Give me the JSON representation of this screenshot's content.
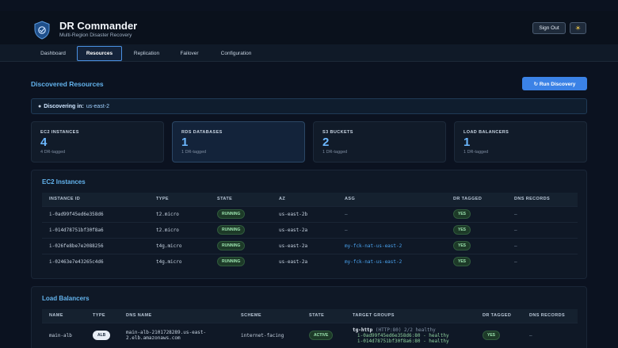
{
  "header": {
    "title": "DR Commander",
    "subtitle": "Multi-Region Disaster Recovery",
    "sign_out_label": "Sign Out",
    "theme_icon": "☀"
  },
  "nav": {
    "tabs": [
      {
        "label": "Dashboard"
      },
      {
        "label": "Resources"
      },
      {
        "label": "Replication"
      },
      {
        "label": "Failover"
      },
      {
        "label": "Configuration"
      }
    ],
    "active_tab": "Resources"
  },
  "main": {
    "title": "Discovered Resources",
    "run_button_label": "↻ Run Discovery",
    "discovering_label": "Discovering in:",
    "discovering_region": "us-east-2",
    "stats": [
      {
        "label": "EC2 INSTANCES",
        "value": "4",
        "sub": "4 DR-tagged"
      },
      {
        "label": "RDS DATABASES",
        "value": "1",
        "sub": "1 DR-tagged"
      },
      {
        "label": "S3 BUCKETS",
        "value": "2",
        "sub": "1 DR-tagged"
      },
      {
        "label": "LOAD BALANCERS",
        "value": "1",
        "sub": "1 DR-tagged"
      }
    ]
  },
  "ec2": {
    "title": "EC2 Instances",
    "columns": [
      "INSTANCE ID",
      "TYPE",
      "STATE",
      "AZ",
      "ASG",
      "DR TAGGED",
      "DNS RECORDS"
    ],
    "rows": [
      {
        "id": "i-0ad99f45ed6e358d6",
        "type": "t2.micro",
        "state": "RUNNING",
        "az": "us-east-2b",
        "asg": "—",
        "dr": "YES",
        "dns": "—"
      },
      {
        "id": "i-014d78751bf30f8a6",
        "type": "t2.micro",
        "state": "RUNNING",
        "az": "us-east-2a",
        "asg": "—",
        "dr": "YES",
        "dns": "—"
      },
      {
        "id": "i-026fe8be7e2088256",
        "type": "t4g.micro",
        "state": "RUNNING",
        "az": "us-east-2a",
        "asg": "my-fck-nat-us-east-2",
        "dr": "YES",
        "dns": "—"
      },
      {
        "id": "i-02463e7e43265c4d6",
        "type": "t4g.micro",
        "state": "RUNNING",
        "az": "us-east-2a",
        "asg": "my-fck-nat-us-east-2",
        "dr": "YES",
        "dns": "—"
      }
    ]
  },
  "lb": {
    "title": "Load Balancers",
    "columns": [
      "NAME",
      "TYPE",
      "DNS NAME",
      "SCHEME",
      "STATE",
      "TARGET GROUPS",
      "DR TAGGED",
      "DNS RECORDS"
    ],
    "rows": [
      {
        "name": "main-alb",
        "type": "ALB",
        "dns_line1": "main-alb-2101728289.us-east-",
        "dns_line2": "2.elb.amazonaws.com",
        "scheme": "internet-facing",
        "state": "ACTIVE",
        "tg_name": "tg-http",
        "tg_info": "(HTTP:80) 2/2 healthy",
        "tg_target1": "i-0ad99f45ed6e358d6:80 - healthy",
        "tg_target2": "i-014d78751bf30f8a6:80 - healthy",
        "dr": "YES",
        "dns": "—"
      }
    ]
  },
  "colors": {
    "accent": "#63b3ed",
    "primary_button": "#3b82e6",
    "background": "#0b1220"
  }
}
